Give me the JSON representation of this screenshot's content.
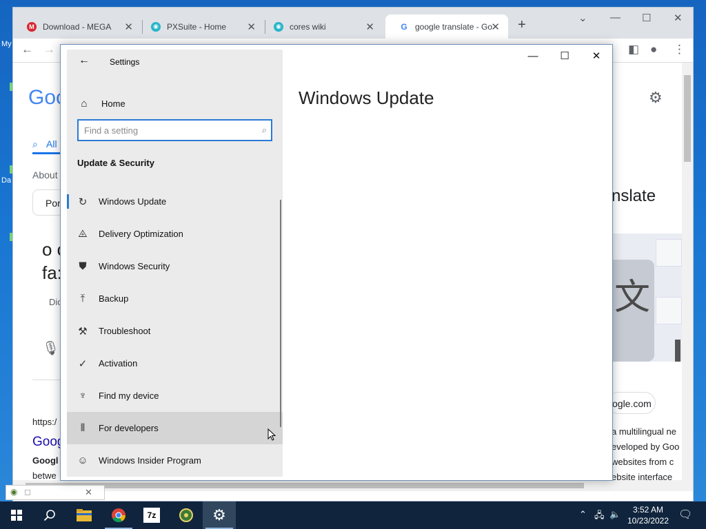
{
  "desktop": {
    "icon_labels": [
      "My",
      "Da"
    ]
  },
  "chrome": {
    "tabs": [
      {
        "title": "Download - MEGA",
        "favicon": "mega-icon",
        "color": "#d9272e",
        "glyph": "M"
      },
      {
        "title": "PXSuite - Home",
        "favicon": "pxsuite-icon",
        "color": "#26b5c9",
        "glyph": "◉"
      },
      {
        "title": "cores wiki",
        "favicon": "cores-wiki-icon",
        "color": "#26b5c9",
        "glyph": "◉"
      },
      {
        "title": "google translate - Go",
        "favicon": "google-icon",
        "color": "#4285f4",
        "glyph": "G"
      }
    ],
    "new_tab": "+",
    "page": {
      "logo_partial": "Goo",
      "tab_all": "All",
      "about": "About",
      "chip_partial": "Por",
      "result_line1": "o c",
      "result_line2": "fa:",
      "dic_partial": "Dic",
      "translate_partial": "nslate",
      "url_partial": "https:/",
      "google_link_partial": "Goog",
      "google_bold_partial": "Googl",
      "between_partial": "betwe",
      "domain_chip": "ogle.com",
      "snippet_lines": [
        "a multilingual ne",
        "eveloped by Goo",
        "websites from c",
        "ebsite interface"
      ]
    },
    "download_bar": {
      "close": "✕"
    }
  },
  "settings": {
    "window_title": "Settings",
    "home_label": "Home",
    "search": {
      "placeholder": "Find a setting",
      "value": ""
    },
    "section_title": "Update & Security",
    "items": [
      {
        "label": "Windows Update",
        "icon": "sync-icon",
        "glyph": "↻"
      },
      {
        "label": "Delivery Optimization",
        "icon": "delivery-optimization-icon",
        "glyph": "⨹"
      },
      {
        "label": "Windows Security",
        "icon": "shield-icon",
        "glyph": "⛊"
      },
      {
        "label": "Backup",
        "icon": "backup-icon",
        "glyph": "⤒"
      },
      {
        "label": "Troubleshoot",
        "icon": "wrench-icon",
        "glyph": "⚒"
      },
      {
        "label": "Activation",
        "icon": "activation-check-icon",
        "glyph": "✓"
      },
      {
        "label": "Find my device",
        "icon": "find-device-icon",
        "glyph": "♆"
      },
      {
        "label": "For developers",
        "icon": "developer-tools-icon",
        "glyph": "⫴"
      },
      {
        "label": "Windows Insider Program",
        "icon": "insider-icon",
        "glyph": "☺"
      }
    ],
    "main_title": "Windows Update"
  },
  "taskbar": {
    "clock_time": "3:52 AM",
    "clock_date": "10/23/2022",
    "apps": [
      {
        "name": "start-button",
        "glyph": "⊞"
      },
      {
        "name": "search-taskbar-button",
        "glyph": "⚲"
      },
      {
        "name": "file-explorer-app",
        "glyph": "▤"
      },
      {
        "name": "chrome-app",
        "glyph": "◎"
      },
      {
        "name": "7zip-app",
        "glyph": "7z"
      },
      {
        "name": "ganttproject-app",
        "glyph": "⚙"
      },
      {
        "name": "settings-app",
        "glyph": "⚙"
      }
    ]
  },
  "colors": {
    "accent": "#2a7ad5",
    "taskbar": "#10243d",
    "sidebar_bg": "#ebebeb"
  }
}
